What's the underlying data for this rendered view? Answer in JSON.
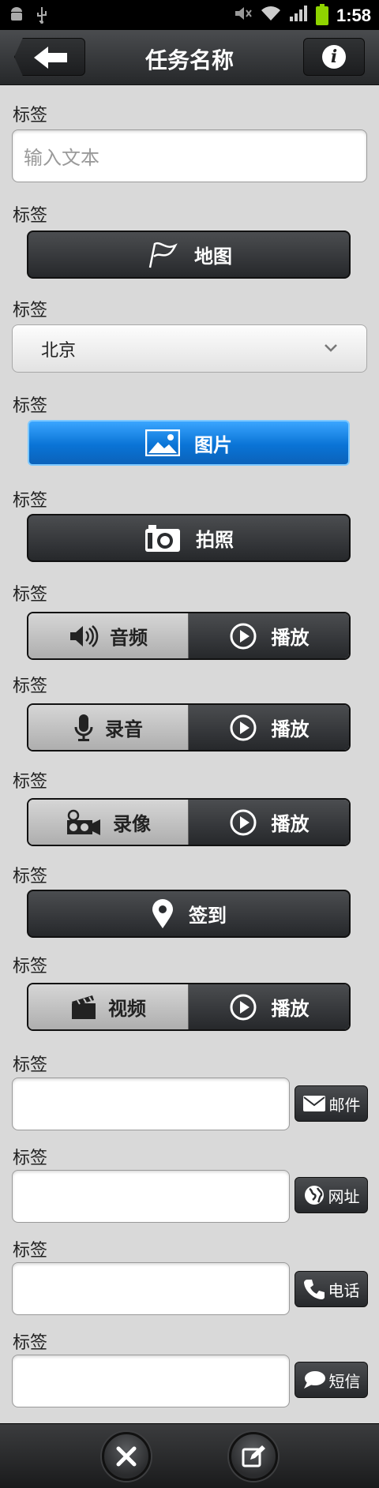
{
  "status_bar": {
    "time": "1:58"
  },
  "header": {
    "title": "任务名称"
  },
  "form": {
    "label": "标签",
    "text_input_placeholder": "输入文本",
    "map_button": "地图",
    "city_select_value": "北京",
    "image_button": "图片",
    "photo_button": "拍照",
    "audio_button": "音频",
    "record_button": "录音",
    "video_record_button": "录像",
    "checkin_button": "签到",
    "video_button": "视频",
    "play_label": "播放",
    "email_button": "邮件",
    "url_button": "网址",
    "phone_button": "电话",
    "sms_button": "短信"
  },
  "colors": {
    "accent_blue": "#0a74d6",
    "dark_button": "#26282b",
    "background": "#d9d9d9"
  }
}
